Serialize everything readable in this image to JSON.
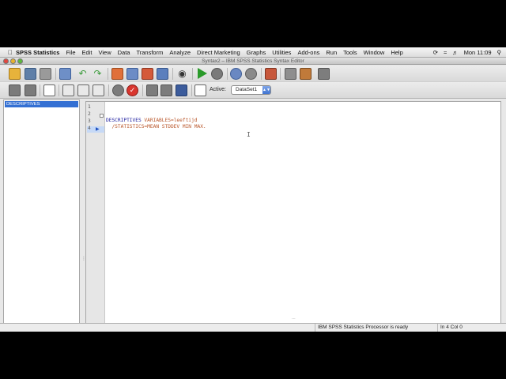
{
  "menubar": {
    "app_name": "SPSS Statistics",
    "items": [
      "File",
      "Edit",
      "View",
      "Data",
      "Transform",
      "Analyze",
      "Direct Marketing",
      "Graphs",
      "Utilities",
      "Add-ons",
      "Run",
      "Tools",
      "Window",
      "Help"
    ],
    "clock": "Mon 11:09"
  },
  "window": {
    "title": "Syntax2 – IBM SPSS Statistics Syntax Editor"
  },
  "toolbar": {
    "active_label": "Active:",
    "dataset_value": "DataSet1"
  },
  "navigation": {
    "selected_item": "DESCRIPTIVES"
  },
  "editor": {
    "line_numbers": [
      "1",
      "2",
      "3",
      "4"
    ],
    "line2_keyword": "DESCRIPTIVES",
    "line2_rest": " VARIABLES=leeftijd",
    "line3": "  /STATISTICS=MEAN STDDEV MIN MAX."
  },
  "status": {
    "processor": "IBM SPSS Statistics Processor is ready",
    "position": "In 4 Col 0"
  },
  "colors": {
    "selection": "#3470d3",
    "keyword": "#1b1b9e",
    "subcommand": "#b9562a",
    "run_green": "#2a9a2a"
  }
}
